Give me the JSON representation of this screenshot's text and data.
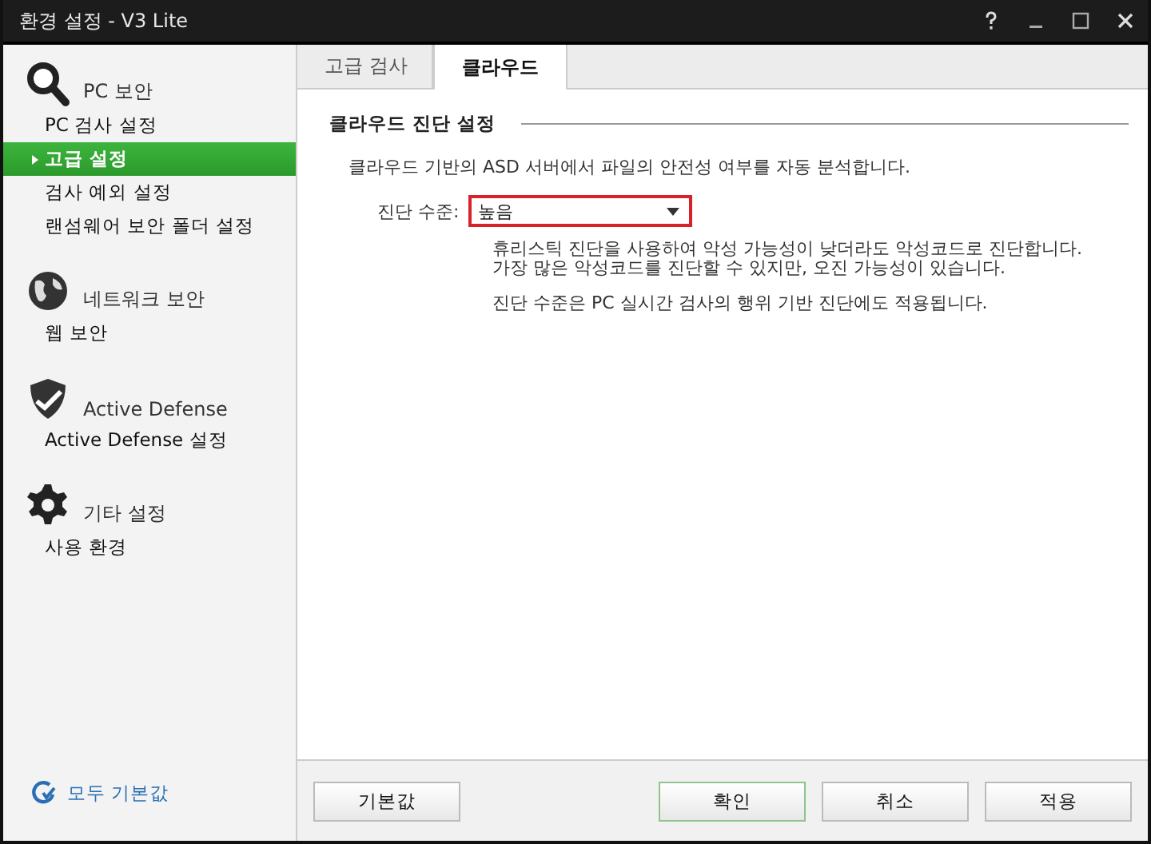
{
  "window": {
    "title": "환경 설정 - V3 Lite",
    "controls": [
      {
        "kind": "help"
      },
      {
        "kind": "minimize"
      },
      {
        "kind": "maximize"
      },
      {
        "kind": "close"
      }
    ]
  },
  "sidebar": {
    "sections": [
      {
        "title": "PC 보안",
        "kind": "search",
        "items": [
          {
            "label": "PC 검사 설정",
            "selected": false
          },
          {
            "label": "고급 설정",
            "selected": true
          },
          {
            "label": "검사 예외 설정",
            "selected": false
          },
          {
            "label": "랜섬웨어 보안 폴더 설정",
            "selected": false
          }
        ]
      },
      {
        "title": "네트워크 보안",
        "kind": "globe",
        "items": [
          {
            "label": "웹 보안",
            "selected": false
          }
        ]
      },
      {
        "title": "Active Defense",
        "kind": "shield",
        "items": [
          {
            "label": "Active Defense 설정",
            "selected": false
          }
        ]
      },
      {
        "title": "기타 설정",
        "kind": "gear",
        "items": [
          {
            "label": "사용 환경",
            "selected": false
          }
        ]
      }
    ],
    "reset_link": "모두 기본값"
  },
  "tabs": [
    {
      "label": "고급 검사",
      "selected": false
    },
    {
      "label": "클라우드",
      "selected": true
    }
  ],
  "group": {
    "title": "클라우드 진단 설정",
    "description": "클라우드 기반의 ASD 서버에서 파일의 안전성 여부를 자동 분석합니다.",
    "field": {
      "label": "진단 수준:",
      "value": "높음",
      "highlighted": true
    },
    "notes": [
      [
        "휴리스틱 진단을 사용하여 악성 가능성이 낮더라도 악성코드로 진단합니다.",
        "가장 많은 악성코드를 진단할 수 있지만, 오진 가능성이 있습니다."
      ],
      [
        "진단 수준은 PC 실시간 검사의 행위 기반 진단에도 적용됩니다."
      ]
    ]
  },
  "buttons": [
    {
      "label": "기본값",
      "primary": false
    },
    {
      "label": "확인",
      "primary": true
    },
    {
      "label": "취소",
      "primary": false
    },
    {
      "label": "적용",
      "primary": false
    }
  ]
}
